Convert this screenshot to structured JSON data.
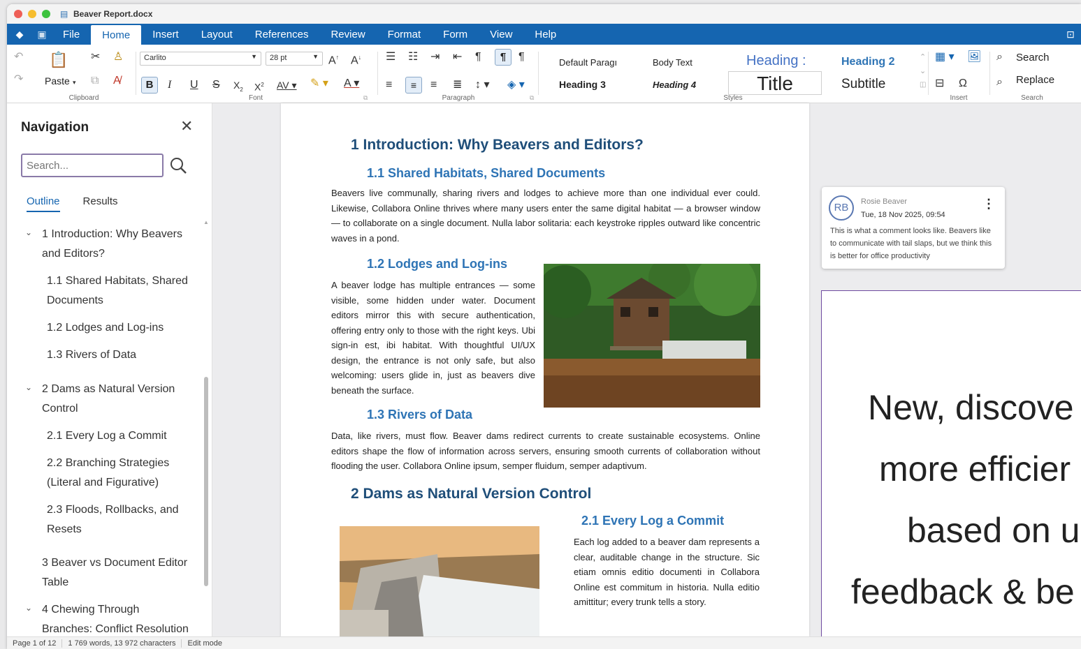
{
  "window": {
    "title": "Beaver Report.docx"
  },
  "menu": {
    "tabs": [
      "File",
      "Home",
      "Insert",
      "Layout",
      "References",
      "Review",
      "Format",
      "Form",
      "View",
      "Help"
    ],
    "active_tab": "Home"
  },
  "ribbon": {
    "clipboard": {
      "paste": "Paste",
      "label": "Clipboard"
    },
    "font": {
      "family": "Carlito",
      "size": "28 pt",
      "label": "Font"
    },
    "paragraph": {
      "label": "Paragraph"
    },
    "styles": {
      "items": [
        "Default Paragı",
        "Body Text",
        "Heading :",
        "Heading 2",
        "Heading 3",
        "Heading 4",
        "Title",
        "Subtitle"
      ],
      "label": "Styles"
    },
    "insert": {
      "label": "Insert"
    },
    "search": {
      "search": "Search",
      "replace": "Replace",
      "label": "Search"
    }
  },
  "navigation": {
    "title": "Navigation",
    "search_placeholder": "Search...",
    "tabs": {
      "outline": "Outline",
      "results": "Results"
    },
    "outline": [
      {
        "line1": "1  Introduction: Why Beavers",
        "line2": "and Editors?"
      },
      {
        "line1": "1.1  Shared Habitats, Shared",
        "line2": "Documents"
      },
      {
        "line1": "1.2  Lodges and Log-ins"
      },
      {
        "line1": "1.3  Rivers of Data"
      },
      {
        "line1": "2  Dams as Natural Version",
        "line2": "Control"
      },
      {
        "line1": "2.1  Every Log a Commit"
      },
      {
        "line1": "2.2  Branching Strategies",
        "line2": "(Literal and Figurative)"
      },
      {
        "line1": "2.3  Floods, Rollbacks, and",
        "line2": "Resets"
      },
      {
        "line1": "3  Beaver vs Document Editor",
        "line2": "Table"
      },
      {
        "line1": "4  Chewing Through",
        "line2": "Branches: Conflict Resolution"
      }
    ]
  },
  "document": {
    "h1_1": "1 Introduction: Why Beavers and Editors?",
    "h2_11": "1.1   Shared Habitats, Shared Documents",
    "p_11": "Beavers live communally, sharing rivers and lodges to achieve more than one individual ever could. Likewise, Collabora Online thrives where many users enter the same digital habitat — a browser window — to collaborate on a single document. Nulla labor solitaria: each keystroke ripples outward like concentric waves in a pond.",
    "h2_12": "1.2   Lodges and Log-ins",
    "p_12": "A beaver lodge has multiple entrances — some visible, some hidden under water. Document editors mirror this with secure authentication, offering entry only to those with the right keys. Ubi sign-in est, ibi habitat. With thoughtful UI/UX design, the entrance is not only safe, but also welcoming: users glide in, just as beavers dive beneath the surface.",
    "h2_13": "1.3   Rivers of Data",
    "p_13": "Data, like rivers, must flow. Beaver dams redirect currents to create sustainable ecosystems. Online editors shape the flow of information across servers, ensuring smooth currents of collaboration without flooding the user. Collabora Online ipsum, semper fluidum, semper adaptivum.",
    "h1_2": "2 Dams as Natural Version Control",
    "h2_21": "2.1    Every Log a Commit",
    "p_21": "Each log added to a beaver dam represents a clear, auditable change in the structure. Sic etiam omnis editio documenti in Collabora Online est commitum in historia. Nulla editio amittitur; every trunk tells a story."
  },
  "comment": {
    "initials": "RB",
    "author": "Rosie Beaver",
    "date": "Tue, 18 Nov 2025, 09:54",
    "text": "This is what a comment looks like. Beavers like to communicate with tail slaps, but we think this is better for office productivity"
  },
  "promo": {
    "lines": [
      "New, discove",
      "more efficier",
      "based on u",
      "feedback & be"
    ]
  },
  "status": {
    "page": "Page 1 of 12",
    "words": "1 769 words, 13 972 characters",
    "mode": "Edit mode"
  }
}
